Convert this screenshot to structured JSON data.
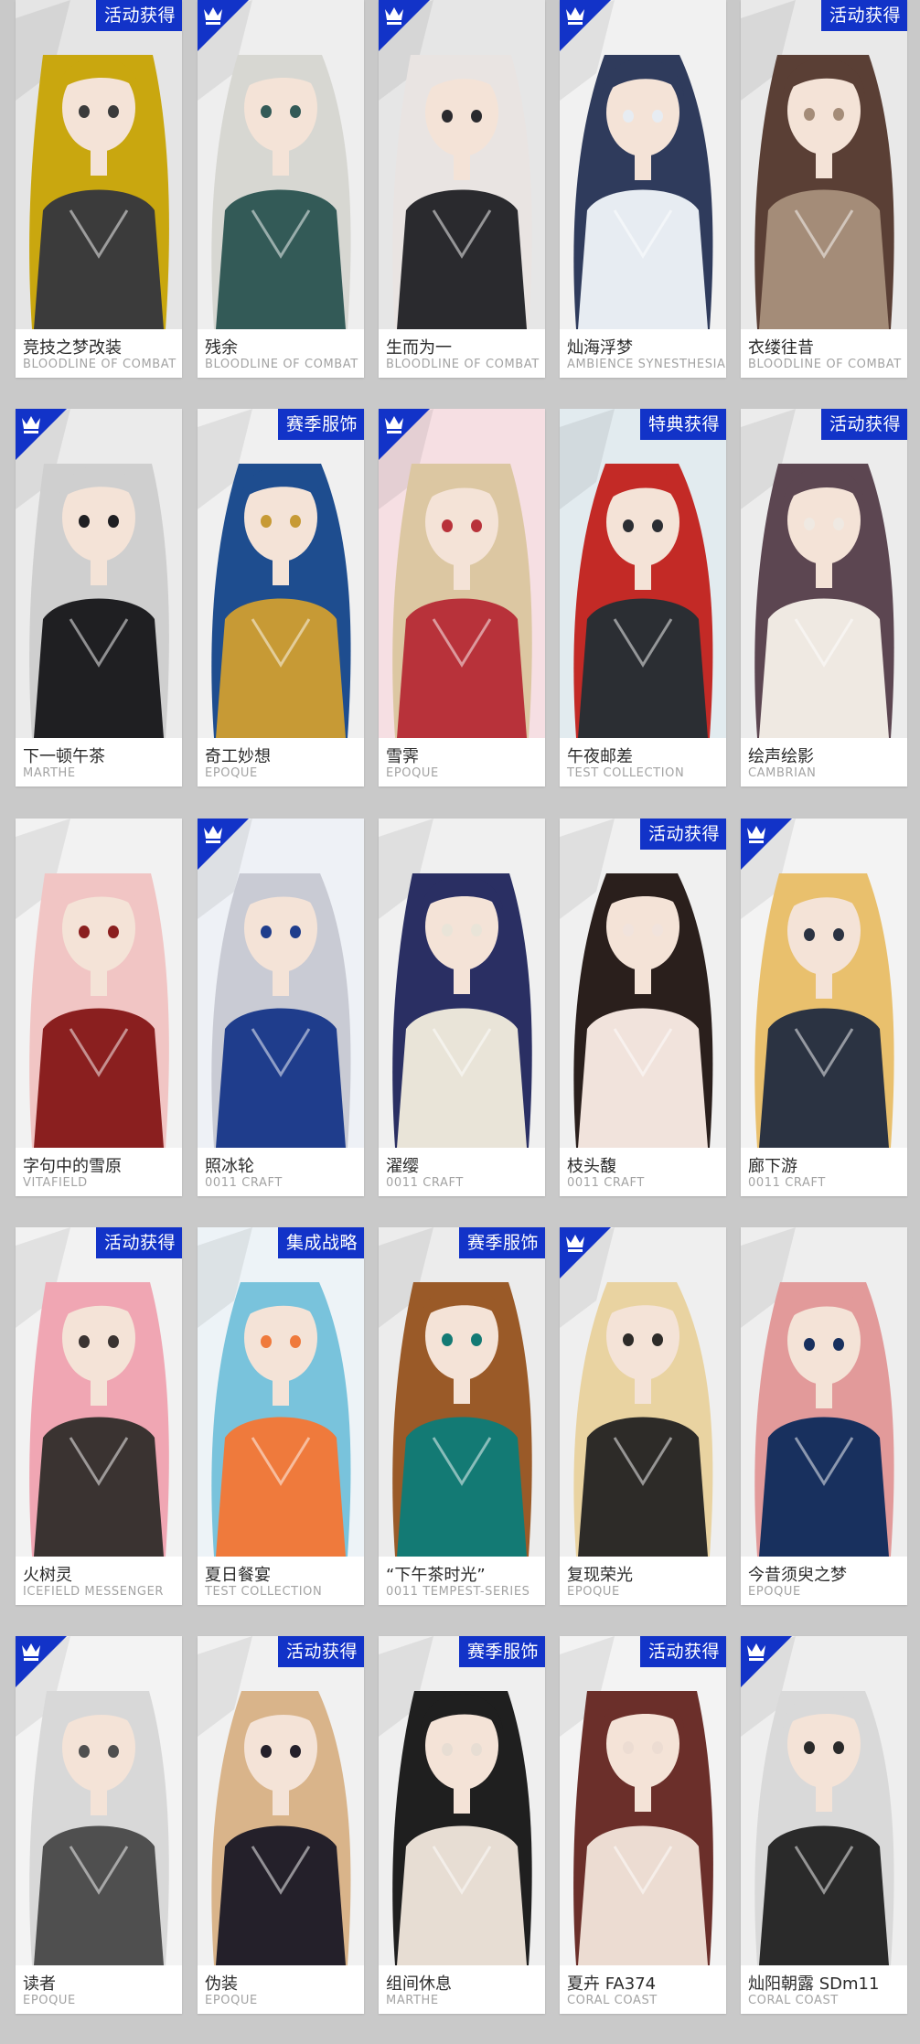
{
  "colors": {
    "page_background": "#c9c9c9",
    "badge_blue": "#1233c8",
    "card_white": "#ffffff",
    "name_text": "#2a2a2a",
    "series_text": "#a3a3a3"
  },
  "cards": [
    {
      "name": "竞技之梦改装",
      "series": "BLOODLINE OF COMBAT",
      "badge": "活动获得",
      "corner_icon": null,
      "palette": [
        "#e5e5e5",
        "#c9a70f",
        "#3b3b3b"
      ]
    },
    {
      "name": "残余",
      "series": "BLOODLINE OF COMBAT",
      "badge": null,
      "corner_icon": "crown-shop-icon",
      "palette": [
        "#eeeeee",
        "#d7d7d2",
        "#335a57"
      ]
    },
    {
      "name": "生而为一",
      "series": "BLOODLINE OF COMBAT",
      "badge": null,
      "corner_icon": "crown-shop-icon",
      "palette": [
        "#e6e6e6",
        "#e9e4e2",
        "#2a2a2e"
      ]
    },
    {
      "name": "灿海浮梦",
      "series": "AMBIENCE SYNESTHESIA",
      "badge": null,
      "corner_icon": "crown-shop-icon",
      "palette": [
        "#f1f1f1",
        "#2f3b5c",
        "#e7ecf2"
      ]
    },
    {
      "name": "衣缕往昔",
      "series": "BLOODLINE OF COMBAT",
      "badge": "活动获得",
      "corner_icon": null,
      "palette": [
        "#e9e9e9",
        "#5a3f35",
        "#a48c78"
      ]
    },
    {
      "name": "下一顿午茶",
      "series": "MARTHE",
      "badge": null,
      "corner_icon": "crown-shop-icon",
      "palette": [
        "#ebebeb",
        "#cfcfcf",
        "#1f1f22"
      ]
    },
    {
      "name": "奇工妙想",
      "series": "EPOQUE",
      "badge": "赛季服饰",
      "corner_icon": null,
      "palette": [
        "#f0f0f0",
        "#1e4d8f",
        "#c79a35"
      ]
    },
    {
      "name": "雪霁",
      "series": "EPOQUE",
      "badge": null,
      "corner_icon": "crown-shop-icon",
      "palette": [
        "#f6dfe3",
        "#dcc7a2",
        "#b8323a"
      ]
    },
    {
      "name": "午夜邮差",
      "series": "TEST COLLECTION",
      "badge": "特典获得",
      "corner_icon": null,
      "palette": [
        "#e2ebef",
        "#c32a26",
        "#2b2e33"
      ]
    },
    {
      "name": "绘声绘影",
      "series": "CAMBRIAN",
      "badge": "活动获得",
      "corner_icon": null,
      "palette": [
        "#ececec",
        "#5c4651",
        "#efe9e2"
      ]
    },
    {
      "name": "字句中的雪原",
      "series": "VITAFIELD",
      "badge": null,
      "corner_icon": null,
      "palette": [
        "#f2f2f2",
        "#f1c5c4",
        "#8a1f1f"
      ]
    },
    {
      "name": "照冰轮",
      "series": "0011 CRAFT",
      "badge": null,
      "corner_icon": "crown-shop-icon",
      "palette": [
        "#eef1f6",
        "#c9cbd4",
        "#1f3d8c"
      ]
    },
    {
      "name": "濯缨",
      "series": "0011 CRAFT",
      "badge": null,
      "corner_icon": null,
      "palette": [
        "#f0f0f0",
        "#2a2f63",
        "#e9e4d8"
      ]
    },
    {
      "name": "枝头馥",
      "series": "0011 CRAFT",
      "badge": "活动获得",
      "corner_icon": null,
      "palette": [
        "#f0f0f0",
        "#2a1f1c",
        "#f1e3dc"
      ]
    },
    {
      "name": "廊下游",
      "series": "0011 CRAFT",
      "badge": null,
      "corner_icon": "crown-shop-icon",
      "palette": [
        "#f3f3f3",
        "#e9c06d",
        "#2b3342"
      ]
    },
    {
      "name": "火树灵",
      "series": "ICEFIELD MESSENGER",
      "badge": "活动获得",
      "corner_icon": null,
      "palette": [
        "#f2f2f2",
        "#f0a6b3",
        "#3a3331"
      ]
    },
    {
      "name": "夏日餐宴",
      "series": "TEST COLLECTION",
      "badge": "集成战略",
      "corner_icon": null,
      "palette": [
        "#edf3f7",
        "#79c3dc",
        "#ef7a3c"
      ]
    },
    {
      "name": "“下午茶时光”",
      "series": "0011 TEMPEST-SERIES",
      "badge": "赛季服饰",
      "corner_icon": null,
      "palette": [
        "#ececec",
        "#9a5a28",
        "#137a74"
      ]
    },
    {
      "name": "复现荣光",
      "series": "EPOQUE",
      "badge": null,
      "corner_icon": "crown-shop-icon",
      "palette": [
        "#efefef",
        "#e9d3a1",
        "#2d2b28"
      ]
    },
    {
      "name": "今昔须臾之梦",
      "series": "EPOQUE",
      "badge": null,
      "corner_icon": null,
      "palette": [
        "#eeeeee",
        "#e29a9a",
        "#18305e"
      ]
    },
    {
      "name": "读者",
      "series": "EPOQUE",
      "badge": null,
      "corner_icon": "crown-shop-icon",
      "palette": [
        "#f3f3f3",
        "#d8d8d8",
        "#4f4f4f"
      ]
    },
    {
      "name": "伪装",
      "series": "EPOQUE",
      "badge": "活动获得",
      "corner_icon": null,
      "palette": [
        "#f1f1f1",
        "#d9b48a",
        "#24202a"
      ]
    },
    {
      "name": "组间休息",
      "series": "MARTHE",
      "badge": "赛季服饰",
      "corner_icon": null,
      "palette": [
        "#efefef",
        "#1f1f1f",
        "#e7ddd3"
      ]
    },
    {
      "name": "夏卉 FA374",
      "series": "CORAL COAST",
      "badge": "活动获得",
      "corner_icon": null,
      "palette": [
        "#f3f3f3",
        "#6b2f2a",
        "#ecdcd2"
      ]
    },
    {
      "name": "灿阳朝露 SDm11",
      "series": "CORAL COAST",
      "badge": null,
      "corner_icon": "crown-shop-icon",
      "palette": [
        "#eeeeee",
        "#d9d9d9",
        "#2a2a2a"
      ]
    }
  ]
}
